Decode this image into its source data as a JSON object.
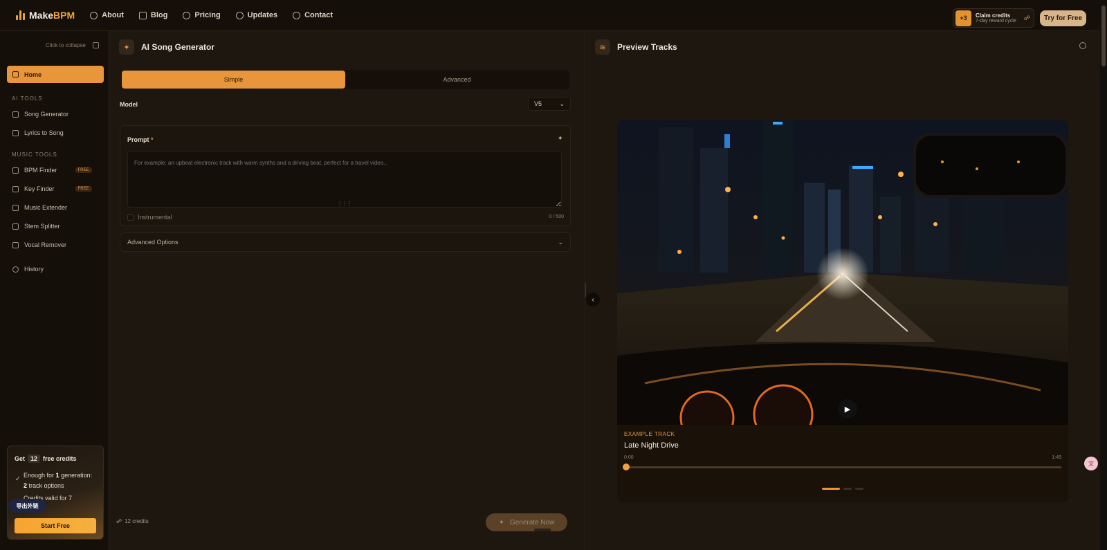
{
  "brand": {
    "name_a": "Make",
    "name_b": "BPM"
  },
  "nav": [
    {
      "label": "About",
      "icon": "info-icon"
    },
    {
      "label": "Blog",
      "icon": "book-icon"
    },
    {
      "label": "Pricing",
      "icon": "coin-icon"
    },
    {
      "label": "Updates",
      "icon": "history-icon"
    },
    {
      "label": "Contact",
      "icon": "help-icon"
    }
  ],
  "claim": {
    "badge": "+3",
    "title": "Claim credits",
    "subtitle": "7-day reward cycle"
  },
  "try_free": "Try for Free",
  "sidebar": {
    "collapse": "Click to collapse",
    "home": "Home",
    "section_ai": "AI TOOLS",
    "section_music": "MUSIC TOOLS",
    "items": [
      {
        "label": "Song Generator"
      },
      {
        "label": "Lyrics to Song"
      },
      {
        "label": "BPM Finder",
        "tag": "FREE"
      },
      {
        "label": "Key Finder",
        "tag": "FREE"
      },
      {
        "label": "Music Extender"
      },
      {
        "label": "Stem Splitter"
      },
      {
        "label": "Vocal Remover"
      },
      {
        "label": "History"
      }
    ],
    "promo": {
      "get": "Get",
      "num": "12",
      "credits": "free credits",
      "line1_a": "Enough for ",
      "line1_b": "1",
      "line1_c": " generation:",
      "line1_d": "2",
      "line1_e": " track options",
      "line2": "Credits valid for 7",
      "button": "Start Free"
    },
    "export": "导出外链"
  },
  "generator": {
    "title": "AI Song Generator",
    "tabs": [
      {
        "label": "Simple"
      },
      {
        "label": "Advanced"
      }
    ],
    "model_label": "Model",
    "model_value": "V5",
    "prompt_label": "Prompt",
    "prompt_required": "*",
    "prompt_placeholder": "For example: an upbeat electronic track with warm synths and a driving beat, perfect for a travel video...",
    "instrumental": "Instrumental",
    "counter": "0 / 500",
    "advanced_options": "Advanced Options",
    "credits": "12 credits",
    "generate": "Generate Now"
  },
  "preview": {
    "title": "Preview Tracks",
    "eyebrow": "EXAMPLE TRACK",
    "track_title": "Late Night Drive",
    "time_start": "0:00",
    "time_end": "1:49",
    "progress": 0.0,
    "carousel_index": 0,
    "carousel_count": 3
  },
  "colors": {
    "accent": "#e8953b",
    "background": "#1a140d",
    "panel": "#1e170f"
  }
}
